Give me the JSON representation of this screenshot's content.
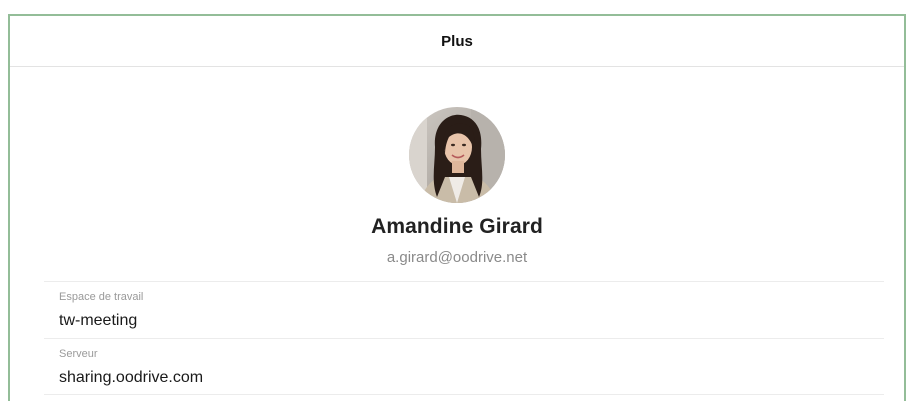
{
  "header": {
    "title": "Plus"
  },
  "profile": {
    "name": "Amandine Girard",
    "email": "a.girard@oodrive.net"
  },
  "info": [
    {
      "label": "Espace de travail",
      "value": "tw-meeting"
    },
    {
      "label": "Serveur",
      "value": "sharing.oodrive.com"
    }
  ],
  "colors": {
    "frame_border": "#93bd98",
    "divider": "#e3e3e3",
    "label_text": "#9a9a9a",
    "email_text": "#8a8a8a"
  }
}
